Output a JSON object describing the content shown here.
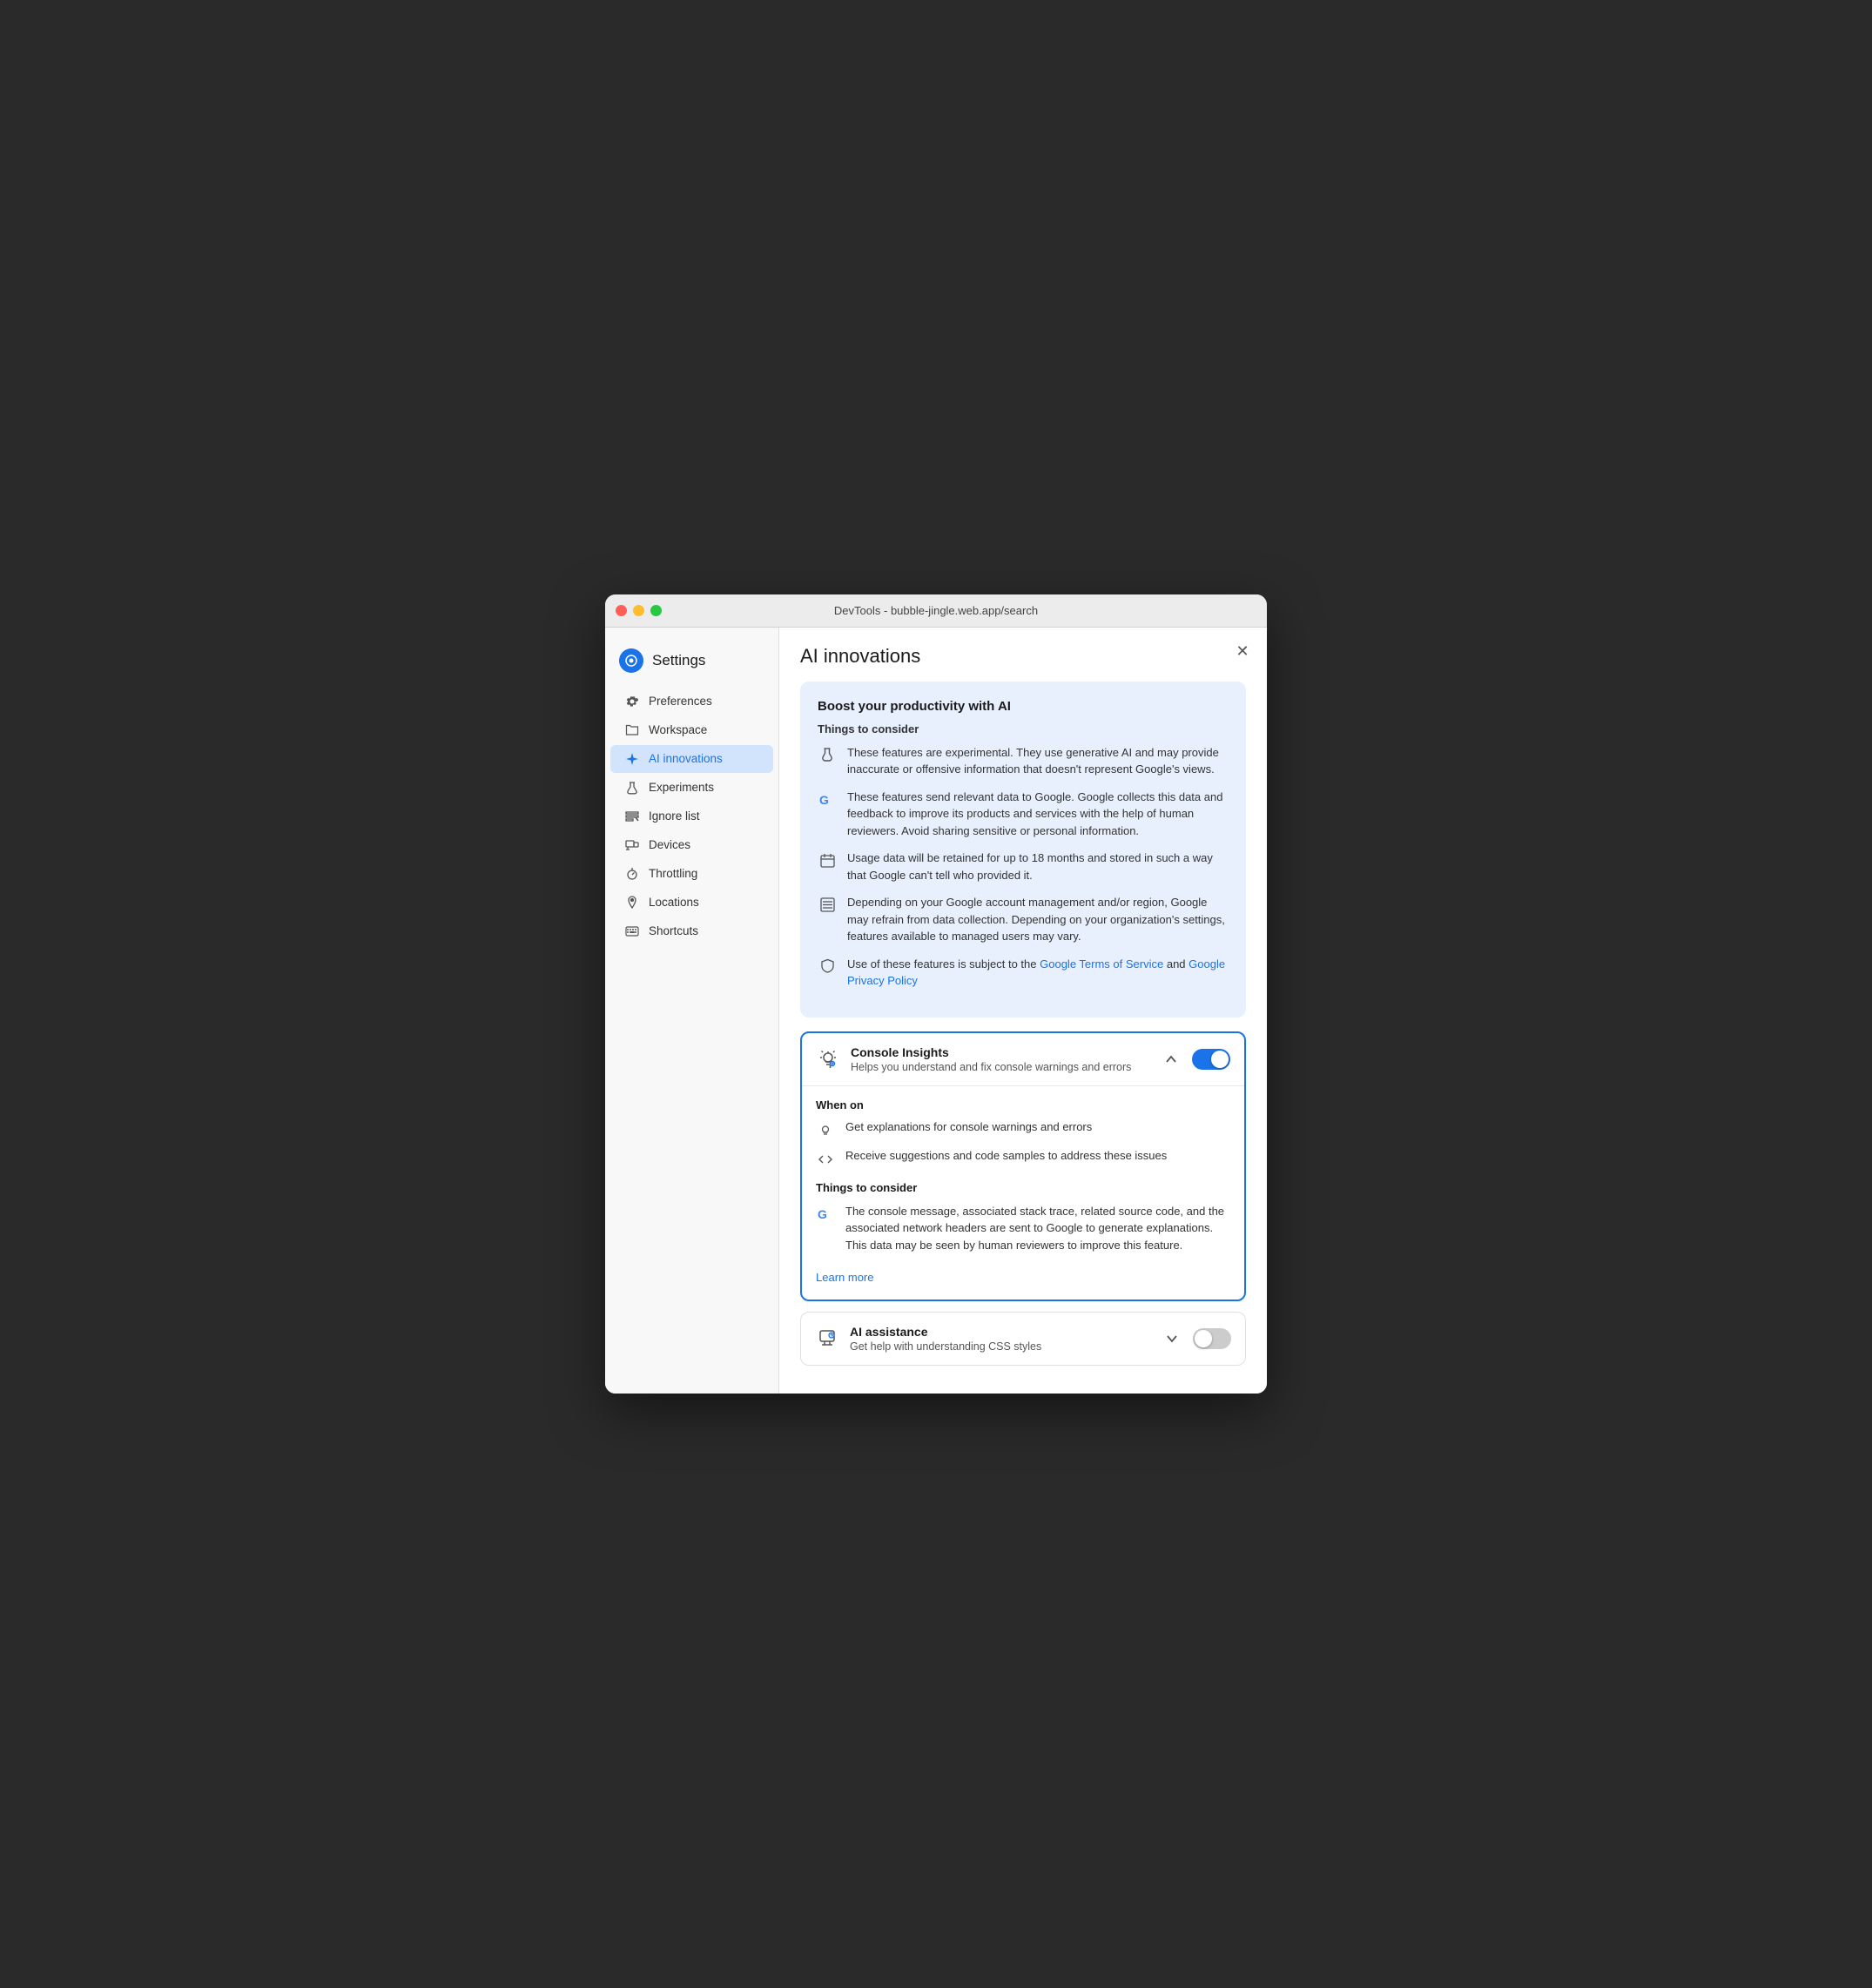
{
  "window": {
    "title": "DevTools - bubble-jingle.web.app/search"
  },
  "sidebar": {
    "title": "Settings",
    "items": [
      {
        "id": "preferences",
        "label": "Preferences",
        "icon": "gear"
      },
      {
        "id": "workspace",
        "label": "Workspace",
        "icon": "folder"
      },
      {
        "id": "ai-innovations",
        "label": "AI innovations",
        "icon": "sparkle",
        "active": true
      },
      {
        "id": "experiments",
        "label": "Experiments",
        "icon": "flask"
      },
      {
        "id": "ignore-list",
        "label": "Ignore list",
        "icon": "ignore"
      },
      {
        "id": "devices",
        "label": "Devices",
        "icon": "devices"
      },
      {
        "id": "throttling",
        "label": "Throttling",
        "icon": "throttle"
      },
      {
        "id": "locations",
        "label": "Locations",
        "icon": "location"
      },
      {
        "id": "shortcuts",
        "label": "Shortcuts",
        "icon": "keyboard"
      }
    ]
  },
  "main": {
    "title": "AI innovations",
    "info_card": {
      "title": "Boost your productivity with AI",
      "things_to_consider": "Things to consider",
      "items": [
        {
          "icon": "experimental",
          "text": "These features are experimental. They use generative AI and may provide inaccurate or offensive information that doesn't represent Google's views."
        },
        {
          "icon": "google",
          "text": "These features send relevant data to Google. Google collects this data and feedback to improve its products and services with the help of human reviewers. Avoid sharing sensitive or personal information."
        },
        {
          "icon": "calendar",
          "text": "Usage data will be retained for up to 18 months and stored in such a way that Google can't tell who provided it."
        },
        {
          "icon": "list",
          "text": "Depending on your Google account management and/or region, Google may refrain from data collection. Depending on your organization's settings, features available to managed users may vary."
        },
        {
          "icon": "shield",
          "text_before": "Use of these features is subject to the ",
          "link1_text": "Google Terms of Service",
          "link1_href": "#",
          "text_middle": " and ",
          "link2_text": "Google Privacy Policy",
          "link2_href": "#"
        }
      ]
    },
    "features": [
      {
        "id": "console-insights",
        "name": "Console Insights",
        "description": "Helps you understand and fix console warnings and errors",
        "enabled": true,
        "expanded": true,
        "when_on_title": "When on",
        "when_on_items": [
          {
            "icon": "bulb",
            "text": "Get explanations for console warnings and errors"
          },
          {
            "icon": "code",
            "text": "Receive suggestions and code samples to address these issues"
          }
        ],
        "considerations_title": "Things to consider",
        "considerations": [
          {
            "icon": "google",
            "text": "The console message, associated stack trace, related source code, and the associated network headers are sent to Google to generate explanations. This data may be seen by human reviewers to improve this feature."
          }
        ],
        "learn_more_text": "Learn more",
        "learn_more_href": "#"
      },
      {
        "id": "ai-assistance",
        "name": "AI assistance",
        "description": "Get help with understanding CSS styles",
        "enabled": false,
        "expanded": false
      }
    ]
  }
}
